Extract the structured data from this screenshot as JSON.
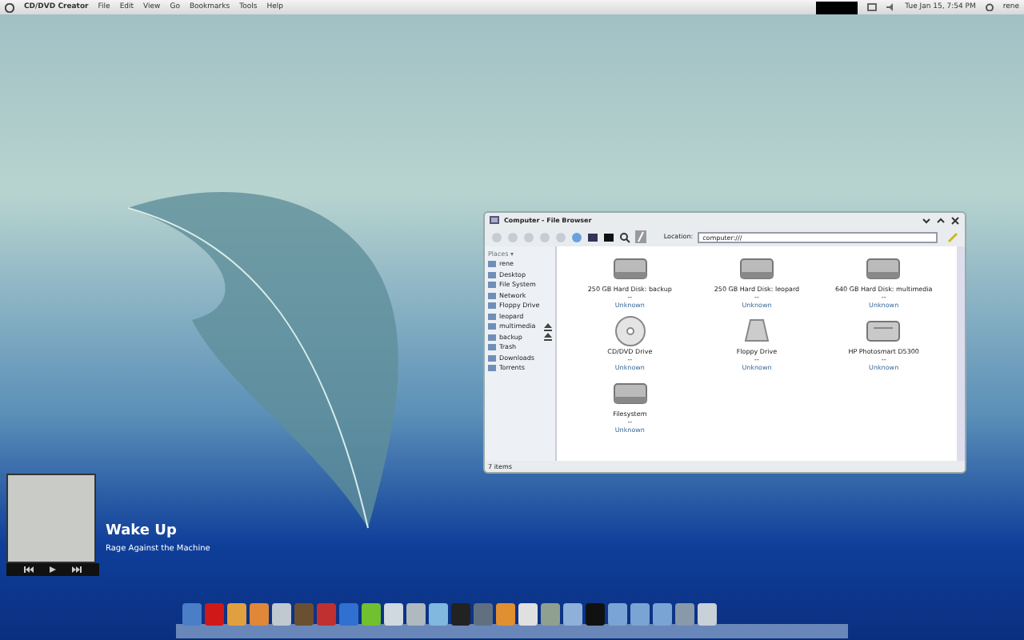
{
  "top_bar": {
    "app_name": "CD/DVD Creator",
    "menus": [
      "File",
      "Edit",
      "View",
      "Go",
      "Bookmarks",
      "Tools",
      "Help"
    ],
    "clock": "Tue Jan 15, 7:54 PM",
    "user": "rene"
  },
  "window": {
    "title": "Computer - File Browser",
    "location_label": "Location:",
    "location": "computer:///",
    "sidebar": {
      "heading": "Places ▾",
      "items": [
        {
          "label": "rene",
          "ejectable": false
        },
        {
          "label": "Desktop",
          "ejectable": false
        },
        {
          "label": "File System",
          "ejectable": false
        },
        {
          "label": "Network",
          "ejectable": false
        },
        {
          "label": "Floppy Drive",
          "ejectable": false
        },
        {
          "label": "leopard",
          "ejectable": false
        },
        {
          "label": "multimedia",
          "ejectable": true
        },
        {
          "label": "backup",
          "ejectable": true
        },
        {
          "label": "Trash",
          "ejectable": false
        },
        {
          "label": "Downloads",
          "ejectable": false
        },
        {
          "label": "Torrents",
          "ejectable": false
        }
      ]
    },
    "items": [
      {
        "kind": "hdd",
        "name": "250 GB Hard Disk: backup",
        "detail": "--",
        "type": "Unknown"
      },
      {
        "kind": "hdd",
        "name": "250 GB Hard Disk: leopard",
        "detail": "--",
        "type": "Unknown"
      },
      {
        "kind": "hdd",
        "name": "640 GB Hard Disk: multimedia",
        "detail": "--",
        "type": "Unknown"
      },
      {
        "kind": "optical",
        "name": "CD/DVD Drive",
        "detail": "--",
        "type": "Unknown"
      },
      {
        "kind": "floppy",
        "name": "Floppy Drive",
        "detail": "--",
        "type": "Unknown"
      },
      {
        "kind": "printer",
        "name": "HP Photosmart D5300",
        "detail": "--",
        "type": "Unknown"
      },
      {
        "kind": "hdd",
        "name": "Filesystem",
        "detail": "--",
        "type": "Unknown"
      }
    ],
    "status": "7 items"
  },
  "player": {
    "title": "Wake Up",
    "artist": "Rage Against the Machine"
  }
}
